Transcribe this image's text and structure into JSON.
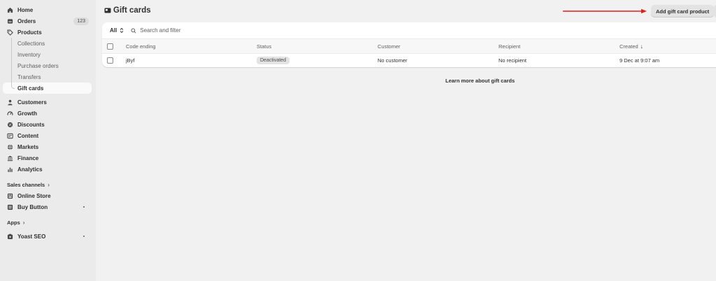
{
  "sidebar": {
    "items": [
      {
        "label": "Home",
        "icon": "home-icon"
      },
      {
        "label": "Orders",
        "icon": "orders-icon",
        "badge": "123"
      },
      {
        "label": "Products",
        "icon": "tag-icon"
      }
    ],
    "product_subitems": [
      "Collections",
      "Inventory",
      "Purchase orders",
      "Transfers",
      "Gift cards"
    ],
    "active_subitem": "Gift cards",
    "more_items": [
      {
        "label": "Customers",
        "icon": "person-icon"
      },
      {
        "label": "Growth",
        "icon": "gauge-icon"
      },
      {
        "label": "Discounts",
        "icon": "discount-icon"
      },
      {
        "label": "Content",
        "icon": "content-icon"
      },
      {
        "label": "Markets",
        "icon": "globe-icon"
      },
      {
        "label": "Finance",
        "icon": "bank-icon"
      },
      {
        "label": "Analytics",
        "icon": "chart-icon"
      }
    ],
    "sales_channels_label": "Sales channels",
    "sales_channels": [
      {
        "label": "Online Store",
        "icon": "store-icon"
      },
      {
        "label": "Buy Button",
        "icon": "buy-button-icon"
      }
    ],
    "apps_label": "Apps",
    "apps": [
      {
        "label": "Yoast SEO",
        "icon": "yoast-icon"
      }
    ]
  },
  "page": {
    "title": "Gift cards",
    "add_button_label": "Add gift card product",
    "learn_more": "Learn more about gift cards"
  },
  "filter": {
    "all_label": "All",
    "search_placeholder": "Search and filter"
  },
  "table": {
    "columns": [
      "Code ending",
      "Status",
      "Customer",
      "Recipient",
      "Created"
    ],
    "sort_indicator": "↓",
    "rows": [
      {
        "code": "jByf",
        "status": "Deactivated",
        "customer": "No customer",
        "recipient": "No recipient",
        "created": "9 Dec at 9:07 am"
      }
    ]
  },
  "colors": {
    "annotation_arrow": "#e02020",
    "sidebar_bg": "#ebebeb",
    "page_bg": "#f1f1f1"
  }
}
